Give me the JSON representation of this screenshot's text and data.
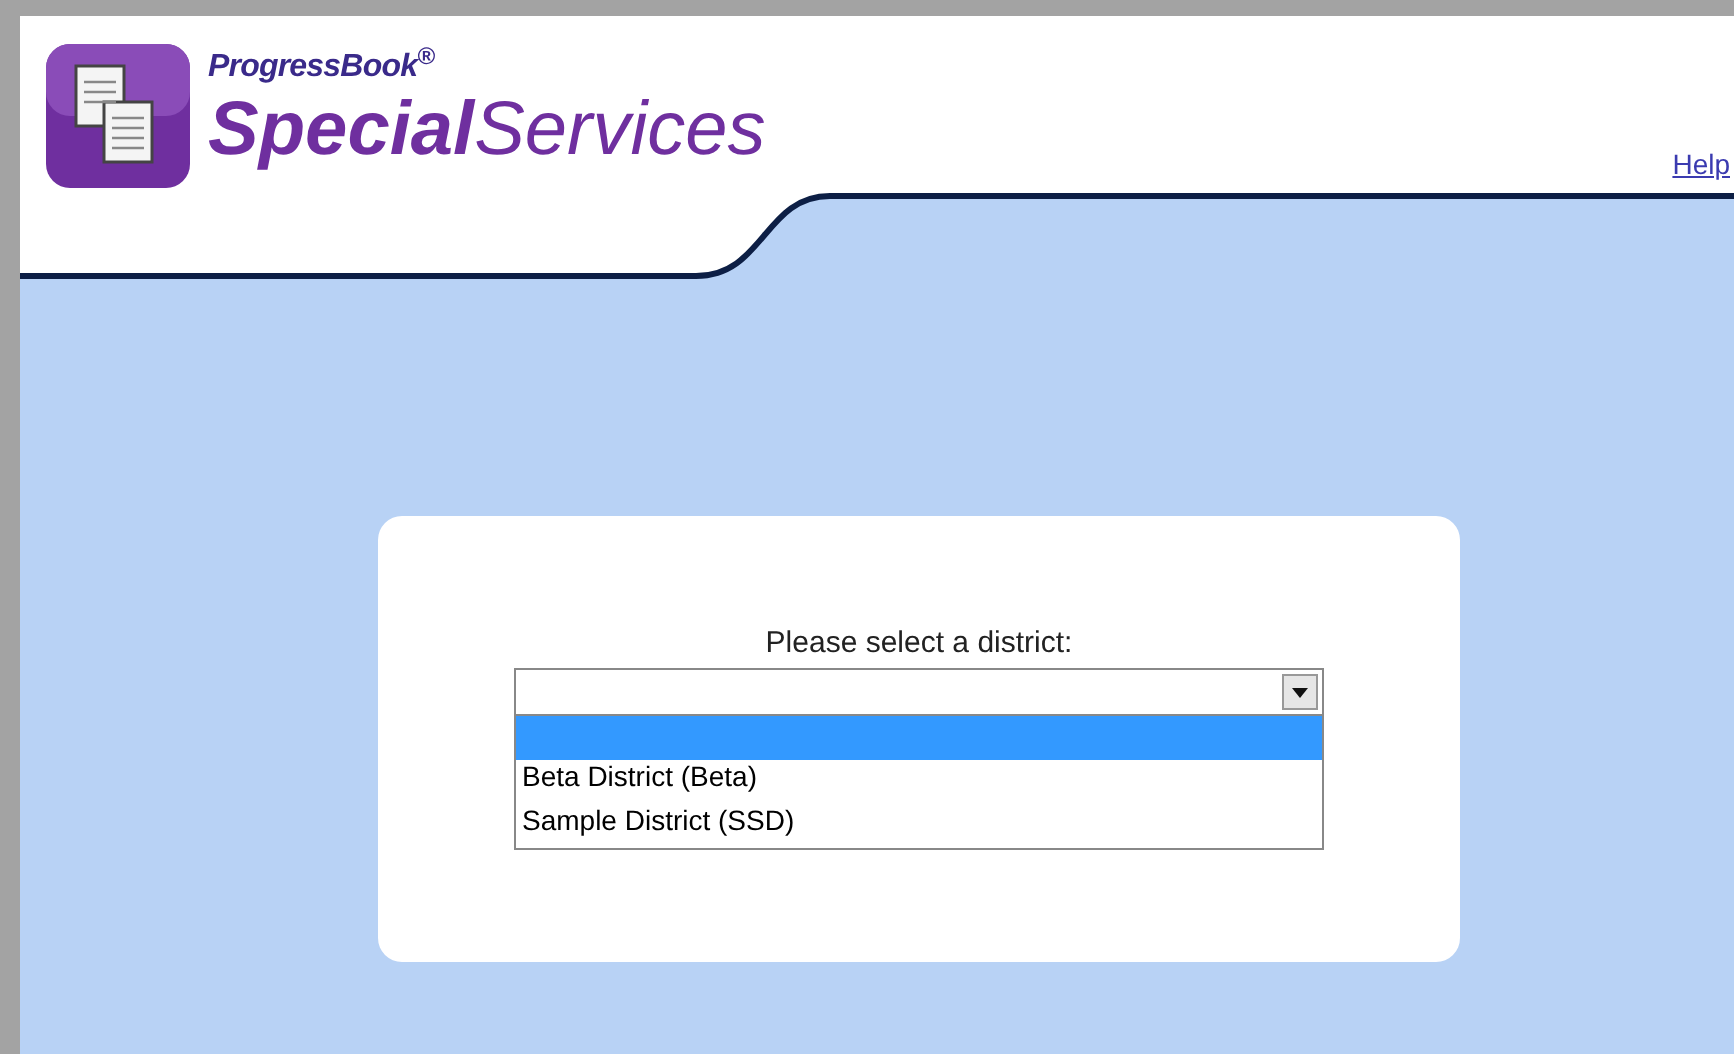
{
  "header": {
    "brand_small": "ProgressBook$^{®}$",
    "brand_bold": "Special",
    "brand_regular": "Services",
    "help_link": "Help"
  },
  "district_picker": {
    "label": "Please select a district:",
    "expanded": true,
    "options": [
      {
        "selected": true
      },
      {
        "label": "Beta District (Beta)",
        "selected": false
      },
      {
        "label": "Sample District (SSD)",
        "selected": false
      }
    ]
  }
}
